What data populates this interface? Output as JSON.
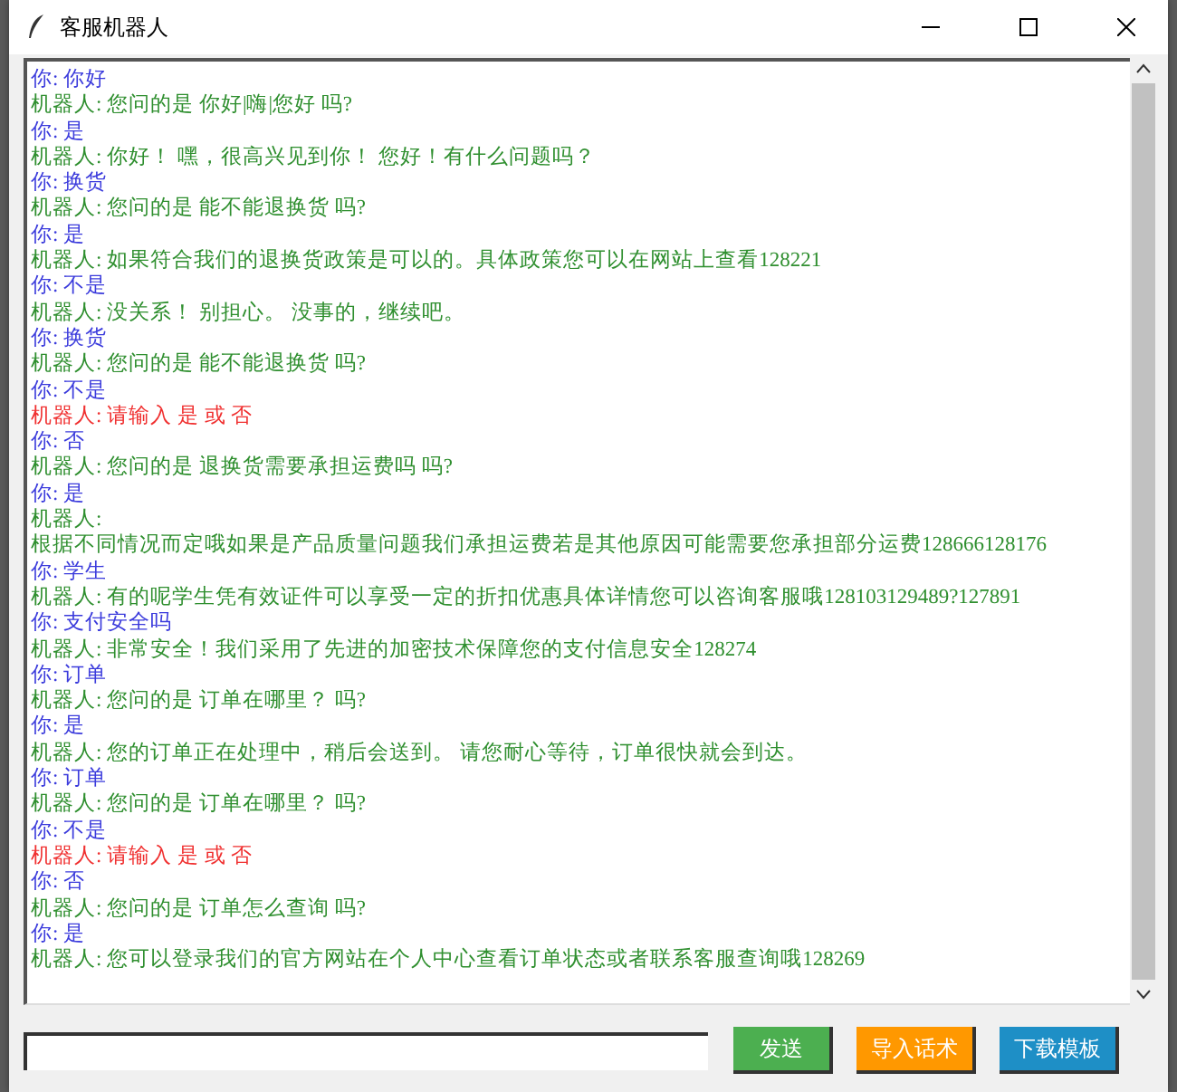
{
  "window": {
    "title": "客服机器人"
  },
  "messages": [
    {
      "kind": "user",
      "text": "你: 你好"
    },
    {
      "kind": "bot",
      "text": "机器人: 您问的是 你好|嗨|您好 吗?"
    },
    {
      "kind": "user",
      "text": "你: 是"
    },
    {
      "kind": "bot",
      "text": "机器人: 你好！ 嘿，很高兴见到你！ 您好！有什么问题吗？"
    },
    {
      "kind": "user",
      "text": "你: 换货"
    },
    {
      "kind": "bot",
      "text": "机器人: 您问的是 能不能退换货 吗?"
    },
    {
      "kind": "user",
      "text": "你: 是"
    },
    {
      "kind": "bot",
      "text": "机器人: 如果符合我们的退换货政策是可以的。具体政策您可以在网站上查看128221"
    },
    {
      "kind": "user",
      "text": "你: 不是"
    },
    {
      "kind": "bot",
      "text": "机器人: 没关系！ 别担心。 没事的，继续吧。"
    },
    {
      "kind": "user",
      "text": "你: 换货"
    },
    {
      "kind": "bot",
      "text": "机器人: 您问的是 能不能退换货 吗?"
    },
    {
      "kind": "user",
      "text": "你: 不是"
    },
    {
      "kind": "error",
      "text": "机器人: 请输入 是 或 否"
    },
    {
      "kind": "user",
      "text": "你: 否"
    },
    {
      "kind": "bot",
      "text": "机器人: 您问的是 退换货需要承担运费吗 吗?"
    },
    {
      "kind": "user",
      "text": "你: 是"
    },
    {
      "kind": "bot",
      "text": "机器人:"
    },
    {
      "kind": "bot",
      "text": "根据不同情况而定哦如果是产品质量问题我们承担运费若是其他原因可能需要您承担部分运费128666128176"
    },
    {
      "kind": "user",
      "text": "你: 学生"
    },
    {
      "kind": "bot",
      "text": "机器人: 有的呢学生凭有效证件可以享受一定的折扣优惠具体详情您可以咨询客服哦128103129489?127891"
    },
    {
      "kind": "user",
      "text": "你: 支付安全吗"
    },
    {
      "kind": "bot",
      "text": "机器人: 非常安全！我们采用了先进的加密技术保障您的支付信息安全128274"
    },
    {
      "kind": "user",
      "text": "你: 订单"
    },
    {
      "kind": "bot",
      "text": "机器人: 您问的是 订单在哪里？ 吗?"
    },
    {
      "kind": "user",
      "text": "你: 是"
    },
    {
      "kind": "bot",
      "text": "机器人: 您的订单正在处理中，稍后会送到。 请您耐心等待，订单很快就会到达。"
    },
    {
      "kind": "user",
      "text": "你: 订单"
    },
    {
      "kind": "bot",
      "text": "机器人: 您问的是 订单在哪里？ 吗?"
    },
    {
      "kind": "user",
      "text": "你: 不是"
    },
    {
      "kind": "error",
      "text": "机器人: 请输入 是 或 否"
    },
    {
      "kind": "user",
      "text": "你: 否"
    },
    {
      "kind": "bot",
      "text": "机器人: 您问的是 订单怎么查询 吗?"
    },
    {
      "kind": "user",
      "text": "你: 是"
    },
    {
      "kind": "bot",
      "text": "机器人: 您可以登录我们的官方网站在个人中心查看订单状态或者联系客服查询哦128269"
    }
  ],
  "buttons": [
    {
      "label": "发送",
      "color": "#4caf50"
    },
    {
      "label": "导入话术",
      "color": "#ff9800"
    },
    {
      "label": "下载模板",
      "color": "#1e8fc6"
    }
  ]
}
